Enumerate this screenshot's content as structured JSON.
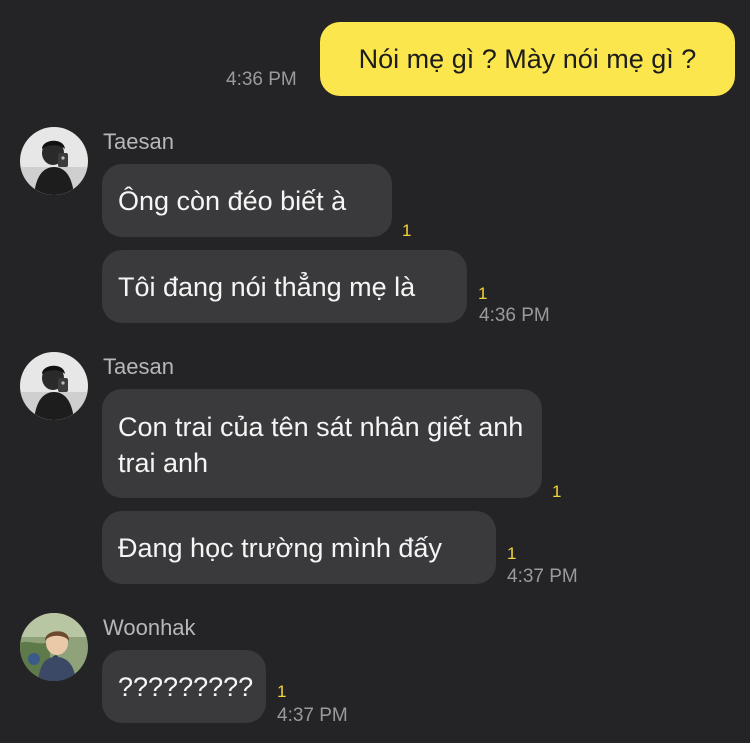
{
  "conversation": {
    "outgoing": {
      "text": "Nói mẹ gì ? Mày nói mẹ gì ?",
      "time": "4:36 PM"
    },
    "groups": [
      {
        "sender": "Taesan",
        "avatar_icon": "person-silhouette-avatar",
        "messages": [
          {
            "text": "Ông còn đéo biết à",
            "unread": "1"
          },
          {
            "text": "Tôi đang nói thẳng mẹ là",
            "unread": "1",
            "time": "4:36 PM"
          }
        ]
      },
      {
        "sender": "Taesan",
        "avatar_icon": "person-silhouette-avatar",
        "messages": [
          {
            "text": "Con trai của tên sát nhân giết anh trai anh",
            "unread": "1"
          },
          {
            "text": "Đang học trường mình đấy",
            "unread": "1",
            "time": "4:37 PM"
          }
        ]
      },
      {
        "sender": "Woonhak",
        "avatar_icon": "person-photo-avatar",
        "messages": [
          {
            "text": "?????????",
            "unread": "1",
            "time": "4:37 PM"
          }
        ]
      }
    ]
  },
  "colors": {
    "background": "#242427",
    "incoming_bubble": "#3a3a3c",
    "outgoing_bubble": "#fce64d",
    "unread_count": "#f3d33a",
    "timestamp": "#9a9a9e"
  }
}
